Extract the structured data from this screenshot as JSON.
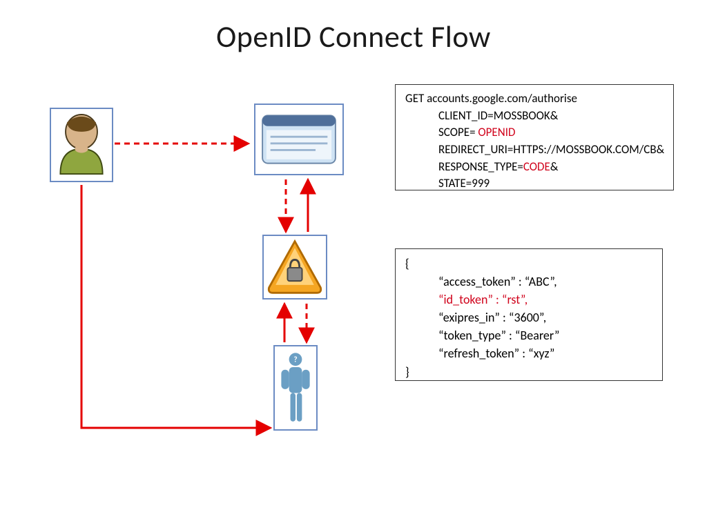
{
  "title": "OpenID Connect Flow",
  "request": {
    "line1": "GET accounts.google.com/authorise",
    "client_id_label": "CLIENT_ID=MOSSBOOK&",
    "scope_label": "SCOPE= ",
    "scope_value": "OPENID",
    "redirect_uri": "REDIRECT_URI=HTTPS://MOSSBOOK.COM/CB&",
    "response_type_label": "RESPONSE_TYPE=",
    "response_type_value": "CODE",
    "response_type_amp": "&",
    "state": "STATE=999"
  },
  "json": {
    "open": "{",
    "access_token": "“access_token” : “ABC”,",
    "id_token": "“id_token” : “rst”,",
    "expires_in": "“exipres_in” : “3600”,",
    "token_type": "“token_type” : “Bearer”",
    "refresh_token": "“refresh_token” : “xyz”",
    "close": "}"
  },
  "icons": {
    "user": "user-icon",
    "browser": "browser-icon",
    "lock": "lock-icon",
    "idp": "person-icon"
  }
}
